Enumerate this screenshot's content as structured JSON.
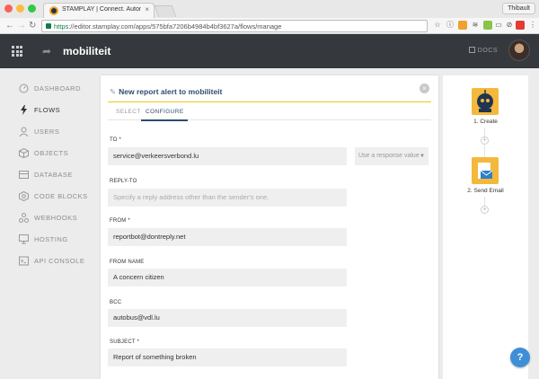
{
  "browser": {
    "tab_title": "STAMPLAY | Connect. Autom",
    "tab_close": "×",
    "user_name": "Thibault",
    "url_https": "https",
    "url_rest": "://editor.stamplay.com/apps/575bfa7206b4984b4bf3627a/flows/manage"
  },
  "header": {
    "app_name": "mobiliteit",
    "docs_label": "DOCS"
  },
  "sidebar": {
    "items": [
      {
        "label": "DASHBOARD",
        "icon": "dashboard-icon"
      },
      {
        "label": "FLOWS",
        "icon": "bolt-icon"
      },
      {
        "label": "USERS",
        "icon": "user-icon"
      },
      {
        "label": "OBJECTS",
        "icon": "cube-icon"
      },
      {
        "label": "DATABASE",
        "icon": "database-icon"
      },
      {
        "label": "CODE BLOCKS",
        "icon": "code-blocks-icon"
      },
      {
        "label": "WEBHOOKS",
        "icon": "webhooks-icon"
      },
      {
        "label": "HOSTING",
        "icon": "monitor-icon"
      },
      {
        "label": "API CONSOLE",
        "icon": "terminal-icon"
      }
    ],
    "active_index": 1
  },
  "modal": {
    "title": "New report alert to mobiliteit",
    "close": "×",
    "tabs": [
      "SELECT",
      "CONFIGURE"
    ],
    "active_tab": "CONFIGURE",
    "fields": {
      "to_label": "TO *",
      "to_value": "service@verkeersverbond.lu",
      "to_select": "Use a response value",
      "replyto_label": "REPLY-TO",
      "replyto_placeholder": "Specify a reply address other than the sender's one.",
      "from_label": "FROM *",
      "from_value": "reportbot@dontreply.net",
      "fromname_label": "FROM NAME",
      "fromname_value": "A concern citizen",
      "bcc_label": "BCC",
      "bcc_value": "autobus@vdl.lu",
      "subject_label": "SUBJECT *",
      "subject_value": "Report of something broken"
    }
  },
  "flow": {
    "steps": [
      {
        "label": "1. Create",
        "icon": "robot-icon"
      },
      {
        "label": "2. Send Email",
        "icon": "email-icon"
      }
    ],
    "plus": "+"
  },
  "help_label": "?",
  "colors": {
    "header_bg": "#35383d",
    "accent_yellow": "#f5c518",
    "title_blue": "#2f4d6e",
    "node_orange": "#f4b83c",
    "help_blue": "#3e8fd8"
  }
}
